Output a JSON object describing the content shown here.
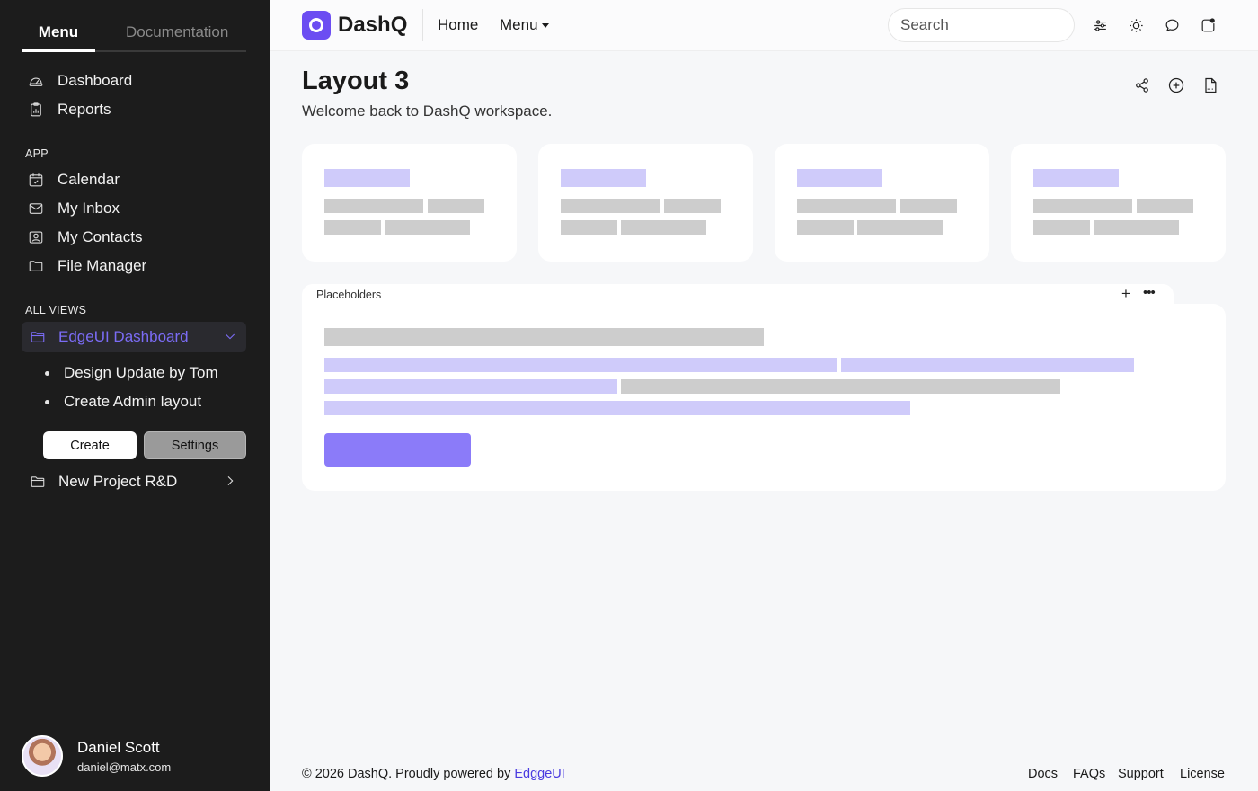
{
  "sidebar": {
    "tabs": [
      "Menu",
      "Documentation"
    ],
    "main_items": [
      {
        "label": "Dashboard",
        "icon": "gauge-icon"
      },
      {
        "label": "Reports",
        "icon": "clipboard-chart-icon"
      }
    ],
    "app_section": "APP",
    "app_items": [
      {
        "label": "Calendar",
        "icon": "calendar-check-icon"
      },
      {
        "label": "My Inbox",
        "icon": "mail-icon"
      },
      {
        "label": "My Contacts",
        "icon": "contact-card-icon"
      },
      {
        "label": "File Manager",
        "icon": "folder-icon"
      }
    ],
    "views_section": "ALL VIEWS",
    "active_group": {
      "label": "EdgeUI Dashboard",
      "icon": "folder-icon",
      "expanded": true
    },
    "sub_items": [
      "Design Update by Tom",
      "Create Admin layout"
    ],
    "create_button": "Create",
    "settings_button": "Settings",
    "project_item": {
      "label": "New Project R&D",
      "icon": "folder-icon"
    },
    "user": {
      "name": "Daniel Scott",
      "email": "daniel@matx.com"
    }
  },
  "header": {
    "brand": "DashQ",
    "links": [
      "Home",
      "Menu"
    ],
    "search_placeholder": "Search",
    "icons": [
      "sliders-icon",
      "sun-icon",
      "chat-icon",
      "notification-icon"
    ]
  },
  "main": {
    "title": "Layout 3",
    "subtitle": "Welcome back to DashQ workspace.",
    "actions": [
      "share-icon",
      "plus-circle-icon",
      "pdf-file-icon"
    ],
    "panel_tab_label": "Placeholders"
  },
  "footer": {
    "copyright": "© 2026 DashQ. Proudly powered by",
    "brand_link": "EdggeUI",
    "links": [
      "Docs",
      "FAQs",
      "Support",
      "License"
    ]
  },
  "colors": {
    "sidebar_bg": "#1c1c1c",
    "accent": "#7b6cf6",
    "placeholder_purple": "#cfcbfa",
    "placeholder_gray": "#cdcdcd",
    "button_purple": "#8b7bf9"
  }
}
